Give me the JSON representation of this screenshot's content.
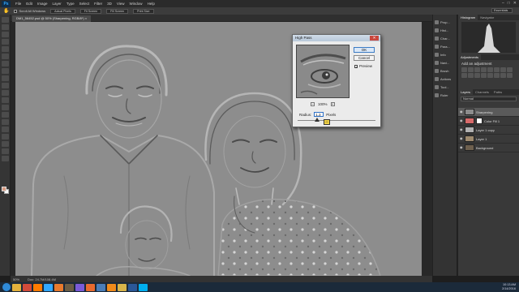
{
  "app": {
    "logo": "Ps",
    "menus": [
      "File",
      "Edit",
      "Image",
      "Layer",
      "Type",
      "Select",
      "Filter",
      "3D",
      "View",
      "Window",
      "Help"
    ],
    "window_controls": [
      "–",
      "□",
      "✕"
    ]
  },
  "options_bar": {
    "scroll_all_windows": "Scroll All Windows",
    "buttons": [
      "Actual Pixels",
      "Fit Screen",
      "Fill Screen",
      "Print Size"
    ],
    "workspace": "Essentials"
  },
  "document": {
    "tab": "DM1_56452.psd @ 50% (Sharpening, RGB/8*) ×",
    "zoom": "50%",
    "doc_size": "Doc: 24.7M/108.4M"
  },
  "dialog": {
    "title": "High Pass",
    "close": "✕",
    "ok": "OK",
    "reset": "Cancel",
    "preview_label": "Preview",
    "preview_checked": true,
    "zoom_out": "−",
    "zoom_in": "+",
    "zoom_value": "100%",
    "radius_label": "Radius:",
    "radius_value": "1.3",
    "radius_unit": "Pixels"
  },
  "icon_strip": [
    {
      "label": "Prop...",
      "icon": "properties-icon"
    },
    {
      "label": "Hist...",
      "icon": "history-icon"
    },
    {
      "label": "Char...",
      "icon": "character-icon"
    },
    {
      "label": "Para...",
      "icon": "paragraph-icon"
    },
    {
      "label": "Info",
      "icon": "info-icon"
    },
    {
      "label": "Navi...",
      "icon": "navigator-icon"
    },
    {
      "label": "Brush",
      "icon": "brush-icon"
    },
    {
      "label": "Actions",
      "icon": "actions-icon"
    },
    {
      "label": "Tool...",
      "icon": "tool-presets-icon"
    },
    {
      "label": "Ruler",
      "icon": "ruler-icon"
    }
  ],
  "panels": {
    "top_tabs": [
      "Histogram",
      "Navigator"
    ],
    "adjustments_tab": "Adjustments",
    "adjustments_subtitle": "Add an adjustment",
    "layers_tabs": [
      "Layers",
      "Channels",
      "Paths"
    ],
    "blend_mode": "Normal",
    "layers": [
      {
        "name": "Sharpening",
        "thumb": "#8c8c8c",
        "selected": true
      },
      {
        "name": "Color Fill 1",
        "thumb": "#d86a6a",
        "selected": false
      },
      {
        "name": "Layer 1 copy",
        "thumb": "#b1b1b1",
        "selected": false
      },
      {
        "name": "Layer 1",
        "thumb": "#9e8a6e",
        "selected": false
      },
      {
        "name": "Background",
        "thumb": "#6e604e",
        "selected": false
      }
    ]
  },
  "taskbar": {
    "apps": [
      {
        "name": "explorer-icon",
        "color": "#e3b13c"
      },
      {
        "name": "chrome-icon",
        "color": "#d24b3a"
      },
      {
        "name": "illustrator-icon",
        "color": "#ff7b00"
      },
      {
        "name": "photoshop-icon",
        "color": "#31a8ff"
      },
      {
        "name": "media-icon",
        "color": "#e87a2c"
      },
      {
        "name": "bridge-icon",
        "color": "#6b5d45"
      },
      {
        "name": "premiere-icon",
        "color": "#7a5ad8"
      },
      {
        "name": "firefox-icon",
        "color": "#e96a2e"
      },
      {
        "name": "lightroom-icon",
        "color": "#4a7db8"
      },
      {
        "name": "vlc-icon",
        "color": "#f08a1a"
      },
      {
        "name": "folder-icon",
        "color": "#d8b44a"
      },
      {
        "name": "word-icon",
        "color": "#2b5797"
      },
      {
        "name": "skype-icon",
        "color": "#00aff0"
      }
    ],
    "time": "10:13 AM",
    "date": "2/14/2016"
  }
}
